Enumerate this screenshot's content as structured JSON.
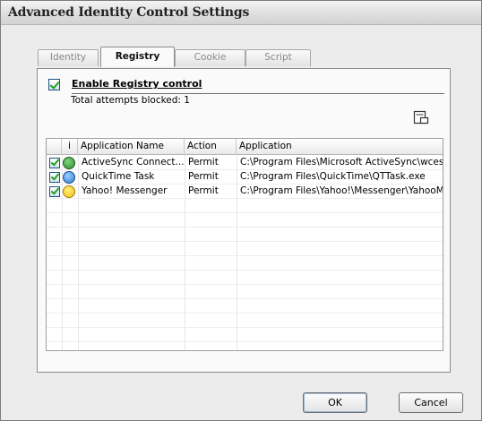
{
  "window": {
    "title": "Advanced Identity Control Settings"
  },
  "tabs": [
    {
      "label": "Identity",
      "active": false
    },
    {
      "label": "Registry",
      "active": true
    },
    {
      "label": "Cookie",
      "active": false
    },
    {
      "label": "Script",
      "active": false
    }
  ],
  "registry": {
    "enable_label": "Enable Registry control",
    "enabled": true,
    "blocked_text": "Total attempts blocked: 1"
  },
  "table": {
    "headers": [
      "i",
      "Application Name",
      "Action",
      "Application"
    ],
    "rows": [
      {
        "checked": true,
        "icon": "activesync-icon",
        "name": "ActiveSync Connect...",
        "action": "Permit",
        "path": "C:\\Program Files\\Microsoft ActiveSync\\wcesc..."
      },
      {
        "checked": true,
        "icon": "quicktime-icon",
        "name": "QuickTime Task",
        "action": "Permit",
        "path": "C:\\Program Files\\QuickTime\\QTTask.exe"
      },
      {
        "checked": true,
        "icon": "yahoo-messenger-icon",
        "name": "Yahoo! Messenger",
        "action": "Permit",
        "path": "C:\\Program Files\\Yahoo!\\Messenger\\YahooMe..."
      }
    ]
  },
  "buttons": {
    "ok": "OK",
    "cancel": "Cancel"
  },
  "colors": {
    "check": "#21a121",
    "activesync": "#2f8f2f",
    "quicktime": "#2a7ad6",
    "yahoo": "#f2c21a"
  }
}
